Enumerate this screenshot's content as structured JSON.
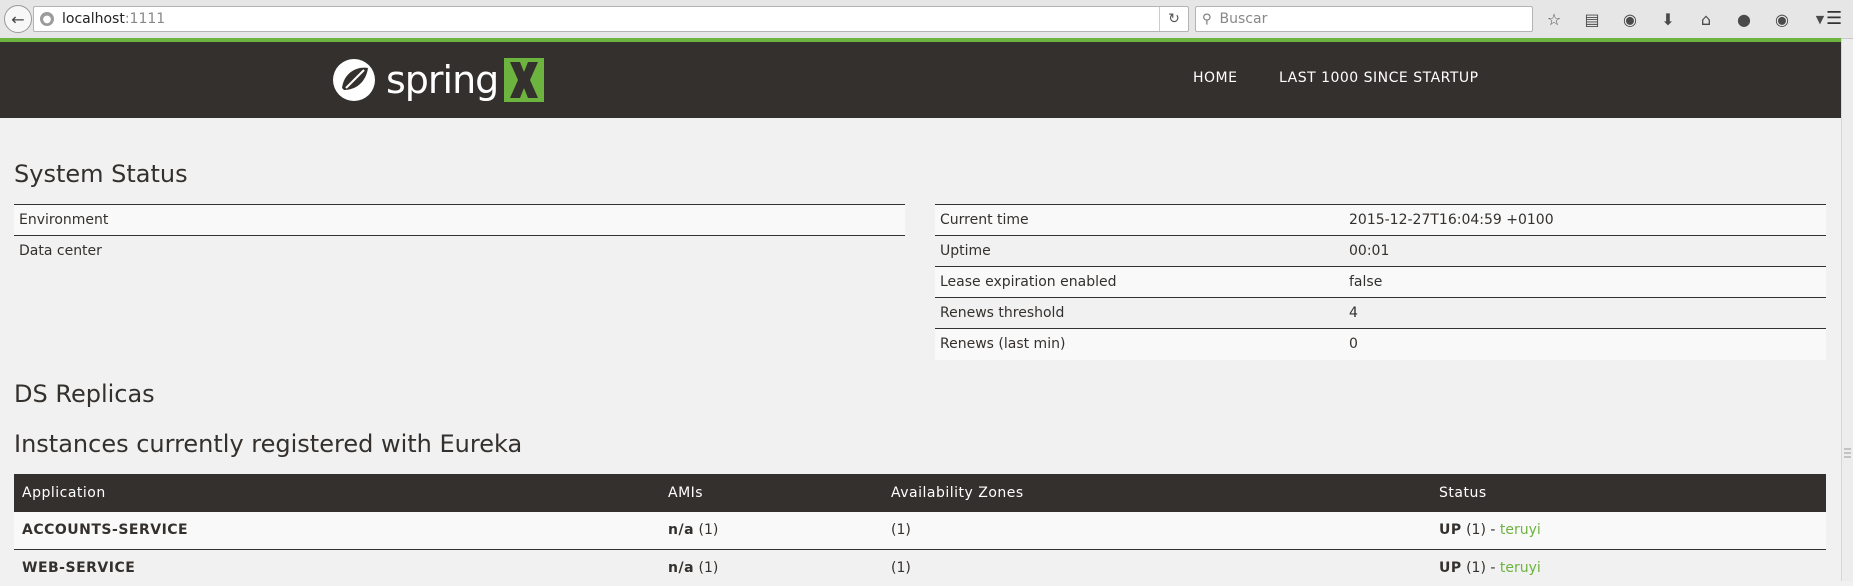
{
  "browser": {
    "url_host": "localhost",
    "url_port": ":1111",
    "search_placeholder": "Buscar"
  },
  "colors": {
    "accent": "#6db33f",
    "navbar": "#34302d",
    "background": "#f1f1f1"
  },
  "navbar": {
    "logo_text": "spring",
    "items": [
      "HOME",
      "LAST 1000 SINCE STARTUP"
    ]
  },
  "system_status": {
    "title": "System Status",
    "left": [
      {
        "label": "Environment",
        "value": ""
      },
      {
        "label": "Data center",
        "value": ""
      }
    ],
    "right": [
      {
        "label": "Current time",
        "value": "2015-12-27T16:04:59 +0100"
      },
      {
        "label": "Uptime",
        "value": "00:01"
      },
      {
        "label": "Lease expiration enabled",
        "value": "false"
      },
      {
        "label": "Renews threshold",
        "value": "4"
      },
      {
        "label": "Renews (last min)",
        "value": "0"
      }
    ]
  },
  "ds_replicas": {
    "title": "DS Replicas"
  },
  "instances": {
    "title": "Instances currently registered with Eureka",
    "columns": [
      "Application",
      "AMIs",
      "Availability Zones",
      "Status"
    ],
    "rows": [
      {
        "application": "ACCOUNTS-SERVICE",
        "amis_bold": "n/a",
        "amis_count": " (1)",
        "zones": "(1)",
        "status_bold": "UP",
        "status_count": " (1) - ",
        "status_link": "teruyi"
      },
      {
        "application": "WEB-SERVICE",
        "amis_bold": "n/a",
        "amis_count": " (1)",
        "zones": "(1)",
        "status_bold": "UP",
        "status_count": " (1) - ",
        "status_link": "teruyi"
      }
    ]
  }
}
